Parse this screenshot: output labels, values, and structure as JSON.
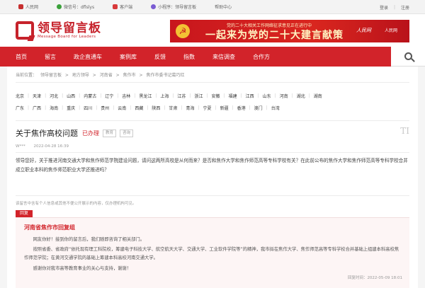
{
  "topbar": {
    "items": [
      {
        "icon": "web-icon",
        "label": "人民网"
      },
      {
        "icon": "wechat-icon",
        "label": "微信号：dflslys"
      },
      {
        "icon": "app-icon",
        "label": "客户端"
      },
      {
        "icon": "miniprogram-icon",
        "label": "小程序：领导留言板"
      },
      {
        "icon": "",
        "label": "帮助中心"
      }
    ],
    "login": "登录",
    "sep": "|",
    "logout": "注册"
  },
  "logo": {
    "title": "领导留言板",
    "subtitle": "Message Board for Leaders"
  },
  "banner": {
    "line1": "党的二十大相关工作网络征求意见正在进行中",
    "line2": "一起来为党的二十大建言献策",
    "brand1": "人民网",
    "brand2": "人民网"
  },
  "nav": {
    "items": [
      "首页",
      "留言",
      "政企直通车",
      "案例库",
      "反馈",
      "指数",
      "来信调查",
      "合作方"
    ]
  },
  "breadcrumb": [
    "当前位置：",
    "领导留言板",
    ">",
    "地方领导",
    ">",
    "河南省",
    ">",
    "焦作市",
    ">",
    "焦作市委书记葛巧红"
  ],
  "regions": {
    "row1": [
      "北京",
      "天津",
      "河北",
      "山西",
      "内蒙古",
      "辽宁",
      "吉林",
      "黑龙江",
      "上海",
      "江苏",
      "浙江",
      "安徽",
      "福建",
      "江西",
      "山东",
      "河南",
      "湖北",
      "湖南"
    ],
    "row2": [
      "广东",
      "广西",
      "海南",
      "重庆",
      "四川",
      "贵州",
      "云南",
      "西藏",
      "陕西",
      "甘肃",
      "青海",
      "宁夏",
      "新疆",
      "香港",
      "澳门",
      "台湾"
    ]
  },
  "message": {
    "title": "关于焦作高校问题",
    "status": "已办理",
    "tag1": "教育",
    "tag2": "咨询",
    "mark": "TI",
    "author": "W***",
    "time": "2022-04-28 16:39",
    "body": "领导您好，关于推进河南交通大学和焦作师范学院建设问题，请问这两所高校是从何而来？是否和焦作大学和焦作师范高等专科学校有关？在此前公布的焦作大学和焦作师范高等专科学校合并成立职业本科的焦作师范职业大学还推进吗？",
    "notice": "该留言中含有个人信息或其他不便公开展示的内容，仅办理机构可见。"
  },
  "reply": {
    "label": "回复",
    "org": "河南省焦作市回复组",
    "p1": "网友你好！接到你的留言后，我们随即咨询了相关部门。",
    "p2": "按照省委、省政府“依托现有理工科院校，筹建电子科技大学、航空航天大学、交通大学、工业软件学院等”的精神，我市拟在焦作大学、焦作师范高等专科学校合并基础上组建本科高校焦作师范学院；在黄河交通学院的基础上筹建本科高校河南交通大学。",
    "p3": "感谢你对我市高等教育事业的关心与支持，谢谢！",
    "time": "回复时间：2022-05-09 18:01"
  }
}
